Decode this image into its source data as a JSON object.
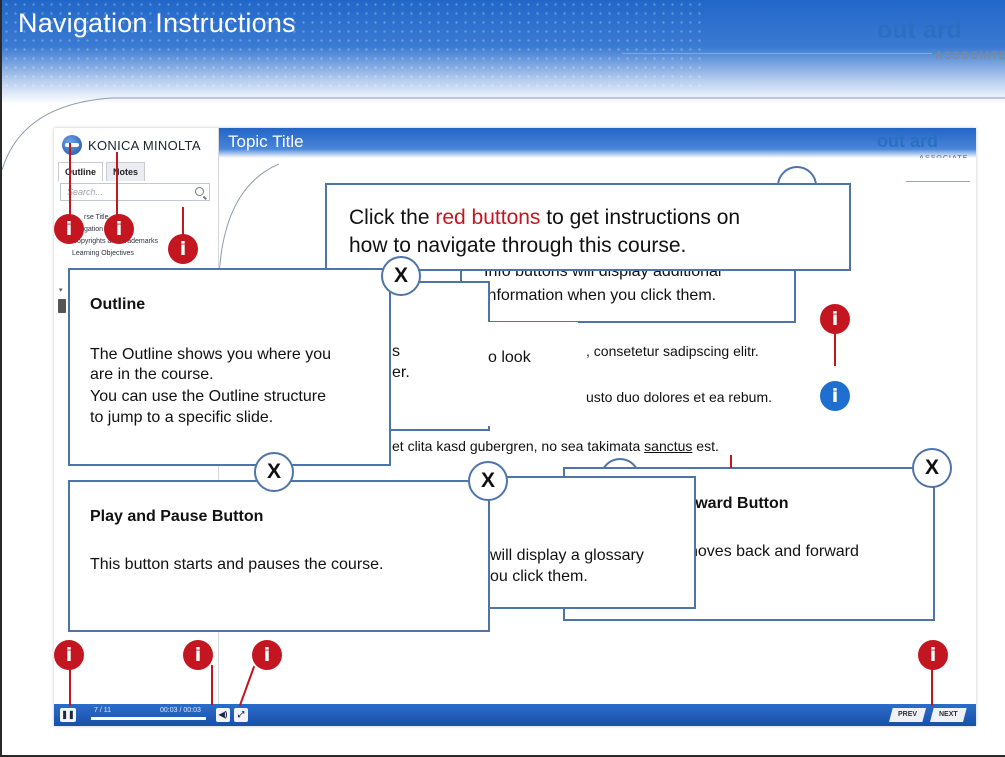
{
  "slide": {
    "title": "Navigation Instructions",
    "logo": {
      "main": "out ard",
      "sub": "ASSOCIATE"
    }
  },
  "player": {
    "brand": "KONICA MINOLTA",
    "tabs": [
      "Outline",
      "Notes"
    ],
    "search_placeholder": "Search...",
    "outline_items": [
      "rse Title",
      "gation ions",
      "Copyrights and Trademarks",
      "Learning Objectives"
    ],
    "topic_title": "Topic Title",
    "logo": {
      "main": "out ard",
      "sub": "ASSOCIATE"
    },
    "controls": {
      "pause_icon": "❚❚",
      "slide_count": "7 / 11",
      "time": "00:03 / 00:03",
      "progress": 1.0,
      "volume_icon": "◀)",
      "fullscreen_icon": "⤢",
      "prev_label": "PREV",
      "next_label": "NEXT"
    }
  },
  "intro": {
    "text_before": "Click the ",
    "red_text": "red buttons",
    "text_after": " to get instructions on",
    "line2": "how to navigate through this course."
  },
  "info_callout": {
    "line1": "Info buttons will display additional",
    "line2": "information when you click them."
  },
  "outline_callout": {
    "heading": "Outline",
    "lines": [
      "The Outline shows you where you",
      "are in the course.",
      "You can use the Outline structure",
      "to jump to a specific slide."
    ]
  },
  "hidden_callout": {
    "line1": "s",
    "line2": "er."
  },
  "look_fragment": "o look",
  "play_callout": {
    "heading": "Play and Pause Button",
    "text": "This button starts and pauses the course."
  },
  "glossary_callout": {
    "line1": "will display a glossary",
    "line2": "ou click them."
  },
  "forward_callout": {
    "heading": "rward Button",
    "line1": "noves back and forward"
  },
  "body_text": {
    "line1": ", consetetur sadipscing elitr.",
    "line2": "usto duo dolores et ea rebum.",
    "line3_before": "et clita kasd gubergren, no sea takimata ",
    "line3_underlined": "sanctus",
    "line3_after": " est."
  },
  "close_label": "X",
  "info_label": "i",
  "colors": {
    "info_red": "#c41621",
    "info_blue": "#1f6fd0",
    "callout_border": "#4f74aa",
    "header_blue": "#2267c8"
  }
}
